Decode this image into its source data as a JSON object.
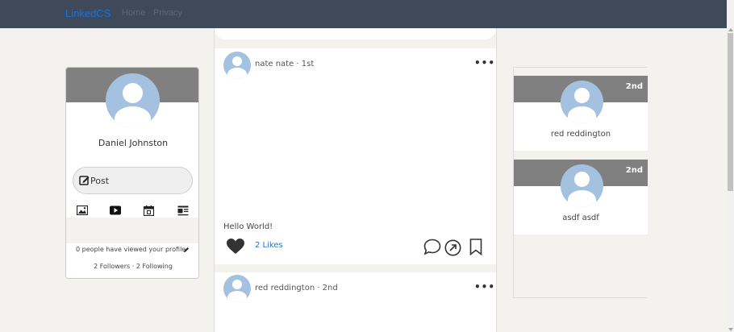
{
  "navbar": {
    "brand": "LinkedCS",
    "links": [
      "Home",
      "Privacy"
    ]
  },
  "profile": {
    "name": "Daniel Johnston",
    "post_label": "Post",
    "media_icons": [
      "image-icon",
      "youtube-icon",
      "calendar-icon",
      "article-icon"
    ],
    "views_text": "0 people have viewed your profile",
    "follow_text": "2 Followers · 2 Following"
  },
  "feed": {
    "posts": [
      {
        "author": "nate nate · 1st",
        "text": "Hello World!",
        "likes": "2 Likes"
      },
      {
        "author": "red reddington · 2nd"
      }
    ]
  },
  "suggestions": [
    {
      "degree": "2nd",
      "name": "red reddington"
    },
    {
      "degree": "2nd",
      "name": "asdf asdf"
    }
  ],
  "colors": {
    "navbar": "#3e4a5a",
    "brand": "#1a73d9",
    "banner": "#808080",
    "avatar": "#a4c1e0",
    "link": "#2b74c7"
  }
}
